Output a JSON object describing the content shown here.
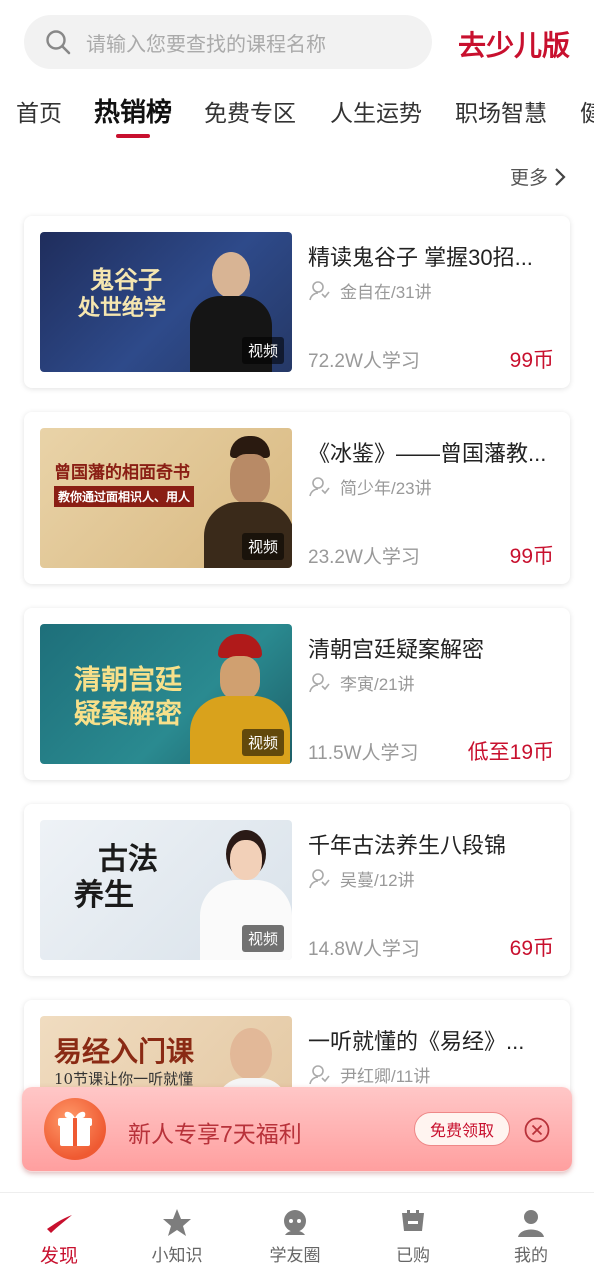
{
  "search": {
    "placeholder": "请输入您要查找的课程名称"
  },
  "header": {
    "kids_link": "去少儿版"
  },
  "tabs": [
    {
      "label": "首页"
    },
    {
      "label": "热销榜"
    },
    {
      "label": "免费专区"
    },
    {
      "label": "人生运势"
    },
    {
      "label": "职场智慧"
    },
    {
      "label": "健"
    }
  ],
  "active_tab": "热销榜",
  "more": {
    "label": "更多"
  },
  "courses": [
    {
      "title": "精读鬼谷子 掌握30招...",
      "author": "金自在/31讲",
      "students": "72.2W人学习",
      "price": "99币",
      "thumb_badge": "视频",
      "thumb_text": [
        "鬼谷子",
        "处世绝学"
      ]
    },
    {
      "title": "《冰鉴》——曾国藩教...",
      "author": "简少年/23讲",
      "students": "23.2W人学习",
      "price": "99币",
      "thumb_badge": "视频",
      "thumb_text": [
        "曾国藩的相面奇书",
        "教你通过面相识人、用人"
      ]
    },
    {
      "title": "清朝宫廷疑案解密",
      "author": "李寅/21讲",
      "students": "11.5W人学习",
      "price": "低至19币",
      "thumb_badge": "视频",
      "thumb_text": [
        "清朝宫廷",
        "疑案解密"
      ]
    },
    {
      "title": "千年古法养生八段锦",
      "author": "吴蔓/12讲",
      "students": "14.8W人学习",
      "price": "69币",
      "thumb_badge": "视频",
      "thumb_text": [
        "古法",
        "养生"
      ]
    },
    {
      "title": "一听就懂的《易经》...",
      "author": "尹红卿/11讲",
      "students": "",
      "price": "",
      "thumb_badge": "",
      "thumb_text": [
        "易经入门课",
        "10节课让你一听就懂"
      ]
    }
  ],
  "promo": {
    "text": "新人专享7天福利",
    "button": "免费领取"
  },
  "bottom_nav": [
    {
      "label": "发现",
      "icon": "discover-icon"
    },
    {
      "label": "小知识",
      "icon": "star-icon"
    },
    {
      "label": "学友圈",
      "icon": "community-icon"
    },
    {
      "label": "已购",
      "icon": "purchased-icon"
    },
    {
      "label": "我的",
      "icon": "profile-icon"
    }
  ],
  "colors": {
    "accent": "#c8102e",
    "promo_bg": "#ffb0b0"
  }
}
